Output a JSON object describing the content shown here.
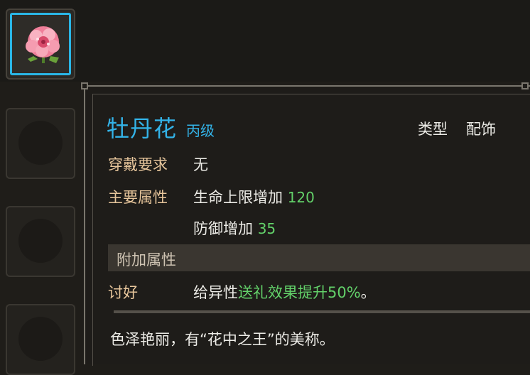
{
  "item": {
    "name": "牡丹花",
    "grade": "丙级",
    "type_label": "类型",
    "type_value": "配饰"
  },
  "stats": {
    "wear_req_label": "穿戴要求",
    "wear_req_value": "无",
    "main_attr_label": "主要属性",
    "main_attr_1_text": "生命上限增加",
    "main_attr_1_value": "120",
    "main_attr_2_text": "防御增加",
    "main_attr_2_value": "35"
  },
  "extra": {
    "section_title": "附加属性",
    "effect_label": "讨好",
    "effect_prefix": "给异性",
    "effect_highlight": "送礼效果提升50%",
    "effect_suffix": "。"
  },
  "description": "色泽艳丽，有“花中之王”的美称。",
  "colors": {
    "title_blue": "#33b3e8",
    "label_tan": "#e6c59b",
    "value_green": "#63d26a",
    "selected_border": "#2ab6e6"
  },
  "icons": {
    "selected_item": "peony-flower-icon"
  }
}
